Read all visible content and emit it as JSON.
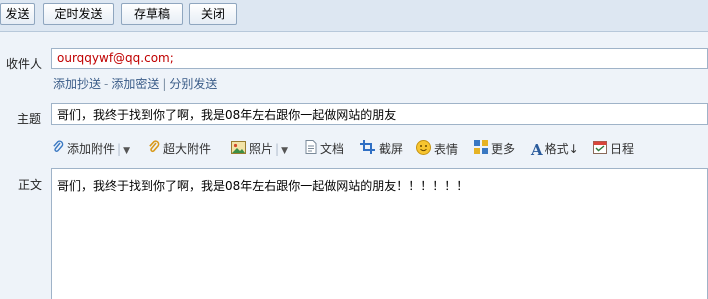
{
  "toolbar": {
    "send_label": "发送",
    "scheduled_send_label": "定时发送",
    "save_draft_label": "存草稿",
    "close_label": "关闭"
  },
  "recipient": {
    "label": "收件人",
    "value": "ourqqywf@qq.com;",
    "add_cc_label": "添加抄送",
    "add_bcc_label": "添加密送",
    "separate_send_label": "分别发送"
  },
  "subject": {
    "label": "主题",
    "value": "哥们，我终于找到你了啊，我是08年左右跟你一起做网站的朋友"
  },
  "attach_toolbar": {
    "add_attachment_label": "添加附件",
    "large_attachment_label": "超大附件",
    "photo_label": "照片",
    "document_label": "文档",
    "screenshot_label": "截屏",
    "emoji_label": "表情",
    "more_label": "更多",
    "format_label": "格式↓",
    "calendar_label": "日程"
  },
  "body": {
    "label": "正文",
    "content": "哥们，我终于找到你了啊，我是08年左右跟你一起做网站的朋友！！！！！！"
  },
  "colors": {
    "recipient_text": "#c00000",
    "link_text": "#3a5c88"
  }
}
